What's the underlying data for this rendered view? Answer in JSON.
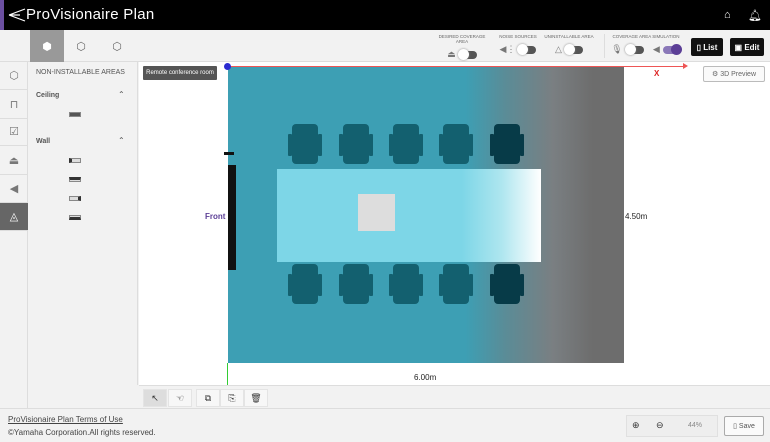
{
  "app": {
    "title": "ProVisionaire Plan",
    "accent": "#6b4fa0"
  },
  "header": {
    "icons": [
      "home-icon",
      "bell-icon"
    ]
  },
  "view_tabs": [
    "top-view",
    "perspective-view",
    "3d-view"
  ],
  "toggles": [
    {
      "label": "DESIRED COVERAGE AREA",
      "icon": "coverage-icon",
      "on": false
    },
    {
      "label": "NOISE SOURCES",
      "icon": "noise-icon",
      "on": false
    },
    {
      "label": "UNINSTALLABLE AREA",
      "icon": "uninstallable-icon",
      "on": false
    },
    {
      "label": "COVERAGE AREA SIMULATION",
      "mic_on": false,
      "speaker_on": true
    }
  ],
  "buttons": {
    "list": "List",
    "edit": "Edit",
    "preview": "3D Preview",
    "save": "Save"
  },
  "panel": {
    "title": "NON-INSTALLABLE AREAS",
    "sections": [
      {
        "label": "Ceiling",
        "items": 1
      },
      {
        "label": "Wall",
        "items": 4
      }
    ]
  },
  "canvas": {
    "room_name": "Remote conference room",
    "axis_x": "X",
    "front": "Front",
    "width": "6.00m",
    "depth": "4.50m"
  },
  "zoom": {
    "level": "44%"
  },
  "footer": {
    "terms": "ProVisionaire Plan Terms of Use",
    "copyright": "©Yamaha Corporation.All rights reserved."
  }
}
